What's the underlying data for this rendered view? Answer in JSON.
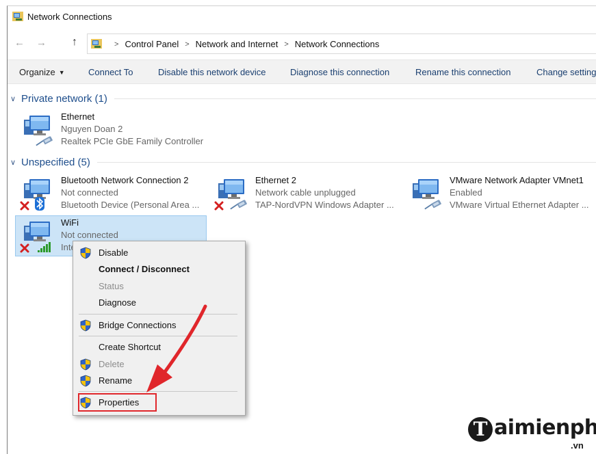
{
  "window": {
    "title": "Network Connections"
  },
  "address": {
    "crumbs": [
      "Control Panel",
      "Network and Internet",
      "Network Connections"
    ]
  },
  "commands": {
    "organize": "Organize",
    "connect_to": "Connect To",
    "disable": "Disable this network device",
    "diagnose": "Diagnose this connection",
    "rename": "Rename this connection",
    "change": "Change settings"
  },
  "groups": [
    {
      "title": "Private network (1)",
      "items": [
        {
          "name": "Ethernet",
          "line2": "Nguyen Doan 2",
          "line3": "Realtek PCIe GbE Family Controller"
        }
      ]
    },
    {
      "title": "Unspecified (5)",
      "items": [
        {
          "name": "Bluetooth Network Connection 2",
          "line2": "Not connected",
          "line3": "Bluetooth Device (Personal Area ..."
        },
        {
          "name": "Ethernet 2",
          "line2": "Network cable unplugged",
          "line3": "TAP-NordVPN Windows Adapter ..."
        },
        {
          "name": "VMware Network Adapter VMnet1",
          "line2": "Enabled",
          "line3": "VMware Virtual Ethernet Adapter ..."
        },
        {
          "name": "WiFi",
          "line2": "Not connected",
          "line3": "Intel"
        }
      ]
    }
  ],
  "context_menu": {
    "items": [
      "Disable",
      "Connect / Disconnect",
      "Status",
      "Diagnose",
      "Bridge Connections",
      "Create Shortcut",
      "Delete",
      "Rename",
      "Properties"
    ]
  },
  "watermark": {
    "brand": "aimienphi",
    "letter": "T",
    "tld": ".vn"
  },
  "colors": {
    "highlight_box": "#e0262b",
    "arrow": "#e0262b",
    "selection": "#cce4f7",
    "group_title": "#1e4e8c"
  }
}
